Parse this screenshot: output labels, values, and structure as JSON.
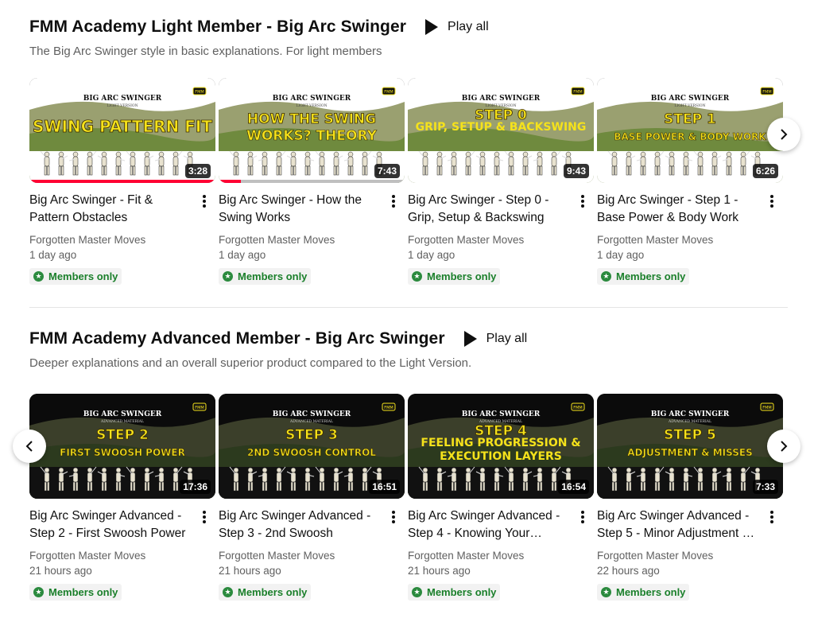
{
  "shelves": [
    {
      "title": "FMM Academy Light Member - Big Arc Swinger",
      "play_all": "Play all",
      "description": "The Big Arc Swinger style in basic explanations. For light members",
      "videos": [
        {
          "thumb_top": "BIG ARC SWINGER",
          "thumb_sub": "LIGHT VERSION",
          "thumb_line1": "SWING PATTERN FIT",
          "thumb_line2": "",
          "duration": "3:28",
          "progress": 1.0,
          "title": "Big Arc Swinger - Fit & Pattern Obstacles",
          "channel": "Forgotten Master Moves",
          "age": "1 day ago",
          "badge": "Members only"
        },
        {
          "thumb_top": "BIG ARC SWINGER",
          "thumb_sub": "LIGHT VERSION",
          "thumb_line1": "HOW THE SWING",
          "thumb_line2": "WORKS? THEORY",
          "duration": "7:43",
          "progress": 0.12,
          "title": "Big Arc Swinger - How the Swing Works",
          "channel": "Forgotten Master Moves",
          "age": "1 day ago",
          "badge": "Members only"
        },
        {
          "thumb_top": "BIG ARC SWINGER",
          "thumb_sub": "LIGHT VERSION",
          "thumb_line1": "STEP 0",
          "thumb_line2": "GRIP, SETUP & BACKSWING",
          "duration": "9:43",
          "progress": 0,
          "title": "Big Arc Swinger - Step 0 - Grip, Setup & Backswing",
          "channel": "Forgotten Master Moves",
          "age": "1 day ago",
          "badge": "Members only"
        },
        {
          "thumb_top": "BIG ARC SWINGER",
          "thumb_sub": "LIGHT VERSION",
          "thumb_line1": "STEP 1",
          "thumb_line2": "BASE POWER & BODY WORK",
          "duration": "6:26",
          "progress": 0,
          "title": "Big Arc Swinger - Step 1 - Base Power & Body Work",
          "channel": "Forgotten Master Moves",
          "age": "1 day ago",
          "badge": "Members only"
        }
      ]
    },
    {
      "title": "FMM Academy Advanced Member - Big Arc Swinger",
      "play_all": "Play all",
      "description": "Deeper explanations and an overall superior product compared to the Light Version.",
      "videos": [
        {
          "thumb_top": "BIG ARC SWINGER",
          "thumb_sub": "ADVANCED MATERIAL",
          "thumb_line1": "STEP 2",
          "thumb_line2": "FIRST SWOOSH POWER",
          "duration": "17:36",
          "progress": 0,
          "title": "Big Arc Swinger Advanced - Step 2 - First Swoosh Power",
          "channel": "Forgotten Master Moves",
          "age": "21 hours ago",
          "badge": "Members only"
        },
        {
          "thumb_top": "BIG ARC SWINGER",
          "thumb_sub": "ADVANCED MATERIAL",
          "thumb_line1": "STEP 3",
          "thumb_line2": "2ND SWOOSH CONTROL",
          "duration": "16:51",
          "progress": 0,
          "title": "Big Arc Swinger Advanced - Step 3 - 2nd Swoosh",
          "channel": "Forgotten Master Moves",
          "age": "21 hours ago",
          "badge": "Members only"
        },
        {
          "thumb_top": "BIG ARC SWINGER",
          "thumb_sub": "ADVANCED MATERIAL",
          "thumb_line1": "STEP 4",
          "thumb_line2": "FEELING PROGRESSION & EXECUTION LAYERS",
          "duration": "16:54",
          "progress": 0,
          "title": "Big Arc Swinger Advanced - Step 4 - Knowing Your…",
          "channel": "Forgotten Master Moves",
          "age": "21 hours ago",
          "badge": "Members only"
        },
        {
          "thumb_top": "BIG ARC SWINGER",
          "thumb_sub": "ADVANCED MATERIAL",
          "thumb_line1": "STEP 5",
          "thumb_line2": "ADJUSTMENT & MISSES",
          "duration": "7:33",
          "progress": 0,
          "title": "Big Arc Swinger Advanced - Step 5 - Minor Adjustment …",
          "channel": "Forgotten Master Moves",
          "age": "22 hours ago",
          "badge": "Members only"
        }
      ]
    }
  ],
  "thumb_logo": "FMM",
  "colors": {
    "thumb_text": "#f5e21b",
    "progress": "#ff0033",
    "badge_text": "#1a7f2a"
  },
  "icons": {
    "play": "play-icon",
    "menu": "more-vert-icon",
    "next": "chevron-right-icon",
    "prev": "chevron-left-icon",
    "badge": "members-star-icon"
  }
}
